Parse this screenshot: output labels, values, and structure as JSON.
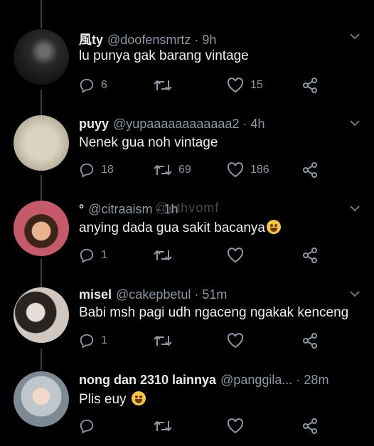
{
  "colors": {
    "background": "#000000",
    "text": "#e8e8e8",
    "muted": "#8b98a5",
    "thread_line": "#3a3f45"
  },
  "watermark": "@ethvomf",
  "tweets": [
    {
      "name": "風ty",
      "handle": "@doofensmrtz",
      "time": "· 9h",
      "text": "lu punya gak barang vintage",
      "reply": "6",
      "retweet": "",
      "like": "15"
    },
    {
      "name": "puyy",
      "handle": "@yupaaaaaaaaaaaa2",
      "time": "· 4h",
      "text": "Nenek gua noh vintage",
      "reply": "18",
      "retweet": "69",
      "like": "186"
    },
    {
      "name": "°",
      "handle": "@citraaism",
      "time": "· 1h",
      "text": "anying dada gua sakit bacanya",
      "reply": "1",
      "retweet": "",
      "like": ""
    },
    {
      "name": "misel",
      "handle": "@cakepbetul",
      "time": "· 51m",
      "text": "Babi msh pagi udh ngaceng ngakak kenceng",
      "reply": "1",
      "retweet": "",
      "like": ""
    },
    {
      "name": "nong dan 2310 lainnya",
      "handle": "@panggila...",
      "time": "· 28m",
      "text": "Plis euy",
      "reply": "",
      "retweet": "",
      "like": ""
    }
  ],
  "icons": {
    "reply": "reply-icon",
    "retweet": "retweet-icon",
    "like": "heart-icon",
    "share": "share-icon",
    "caret": "chevron-down-icon",
    "emoji": "crying-laughing-emoji-icon"
  }
}
